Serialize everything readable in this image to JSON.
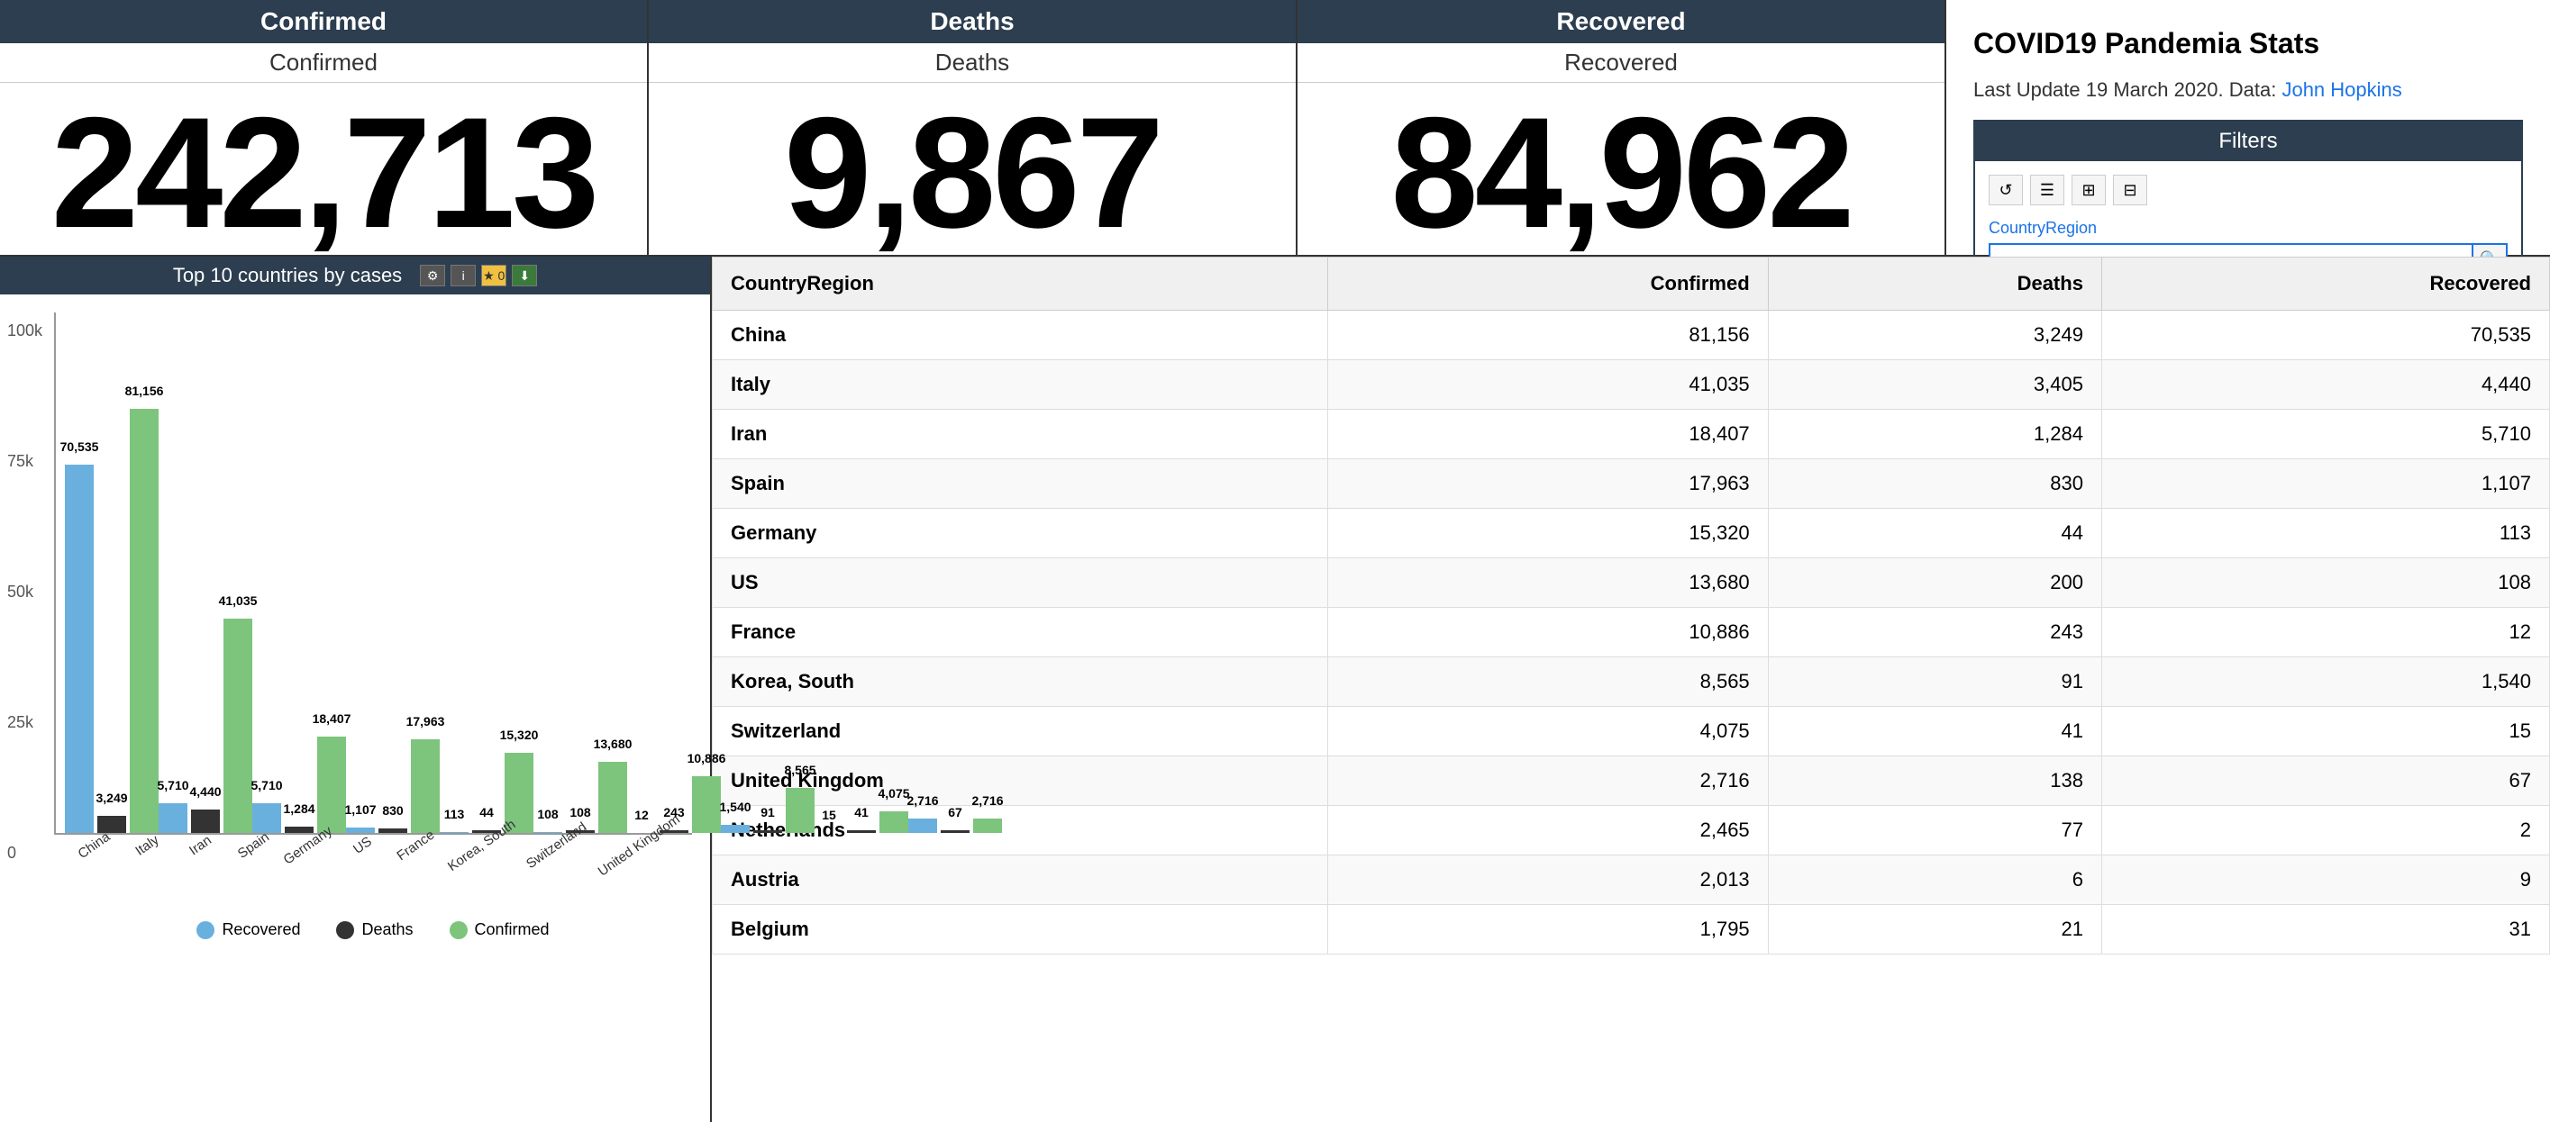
{
  "header": {
    "confirmed_title": "Confirmed",
    "confirmed_sub": "Confirmed",
    "confirmed_value": "242,713",
    "deaths_title": "Deaths",
    "deaths_sub": "Deaths",
    "deaths_value": "9,867",
    "recovered_title": "Recovered",
    "recovered_sub": "Recovered",
    "recovered_value": "84,962"
  },
  "info": {
    "title": "COVID19 Pandemia Stats",
    "update_text": "Last Update 19 March 2020. Data:",
    "data_source": "John Hopkins"
  },
  "filters": {
    "title": "Filters",
    "country_label": "CountryRegion",
    "search_placeholder": ""
  },
  "chart": {
    "title": "Top 10 countries by cases",
    "y_label_100k": "100k",
    "y_label_75k": "75k",
    "y_label_50k": "50k",
    "y_label_25k": "25k",
    "y_label_0": "0",
    "legend": {
      "recovered": "Recovered",
      "deaths": "Deaths",
      "confirmed": "Confirmed"
    },
    "countries": [
      {
        "name": "China",
        "confirmed": 81156,
        "deaths": 3249,
        "recovered": 70535
      },
      {
        "name": "Italy",
        "confirmed": 41035,
        "deaths": 4440,
        "recovered": 5710
      },
      {
        "name": "Iran",
        "confirmed": 18407,
        "deaths": 1284,
        "recovered": 5710
      },
      {
        "name": "Spain",
        "confirmed": 17963,
        "deaths": 830,
        "recovered": 1107
      },
      {
        "name": "Germany",
        "confirmed": 15320,
        "deaths": 44,
        "recovered": 113
      },
      {
        "name": "US",
        "confirmed": 13680,
        "deaths": 108,
        "recovered": 108
      },
      {
        "name": "France",
        "confirmed": 10886,
        "deaths": 243,
        "recovered": 12
      },
      {
        "name": "Korea, South",
        "confirmed": 8565,
        "deaths": 91,
        "recovered": 1540
      },
      {
        "name": "Switzerland",
        "confirmed": 4075,
        "deaths": 41,
        "recovered": 15
      },
      {
        "name": "United Kingdom",
        "confirmed": 2716,
        "deaths": 67,
        "recovered": 2716
      }
    ]
  },
  "table": {
    "headers": [
      "CountryRegion",
      "Confirmed",
      "Deaths",
      "Recovered"
    ],
    "rows": [
      {
        "country": "China",
        "confirmed": "81,156",
        "deaths": "3,249",
        "recovered": "70,535"
      },
      {
        "country": "Italy",
        "confirmed": "41,035",
        "deaths": "3,405",
        "recovered": "4,440"
      },
      {
        "country": "Iran",
        "confirmed": "18,407",
        "deaths": "1,284",
        "recovered": "5,710"
      },
      {
        "country": "Spain",
        "confirmed": "17,963",
        "deaths": "830",
        "recovered": "1,107"
      },
      {
        "country": "Germany",
        "confirmed": "15,320",
        "deaths": "44",
        "recovered": "113"
      },
      {
        "country": "US",
        "confirmed": "13,680",
        "deaths": "200",
        "recovered": "108"
      },
      {
        "country": "France",
        "confirmed": "10,886",
        "deaths": "243",
        "recovered": "12"
      },
      {
        "country": "Korea, South",
        "confirmed": "8,565",
        "deaths": "91",
        "recovered": "1,540"
      },
      {
        "country": "Switzerland",
        "confirmed": "4,075",
        "deaths": "41",
        "recovered": "15"
      },
      {
        "country": "United Kingdom",
        "confirmed": "2,716",
        "deaths": "138",
        "recovered": "67"
      },
      {
        "country": "Netherlands",
        "confirmed": "2,465",
        "deaths": "77",
        "recovered": "2"
      },
      {
        "country": "Austria",
        "confirmed": "2,013",
        "deaths": "6",
        "recovered": "9"
      },
      {
        "country": "Belgium",
        "confirmed": "1,795",
        "deaths": "21",
        "recovered": "31"
      }
    ]
  }
}
